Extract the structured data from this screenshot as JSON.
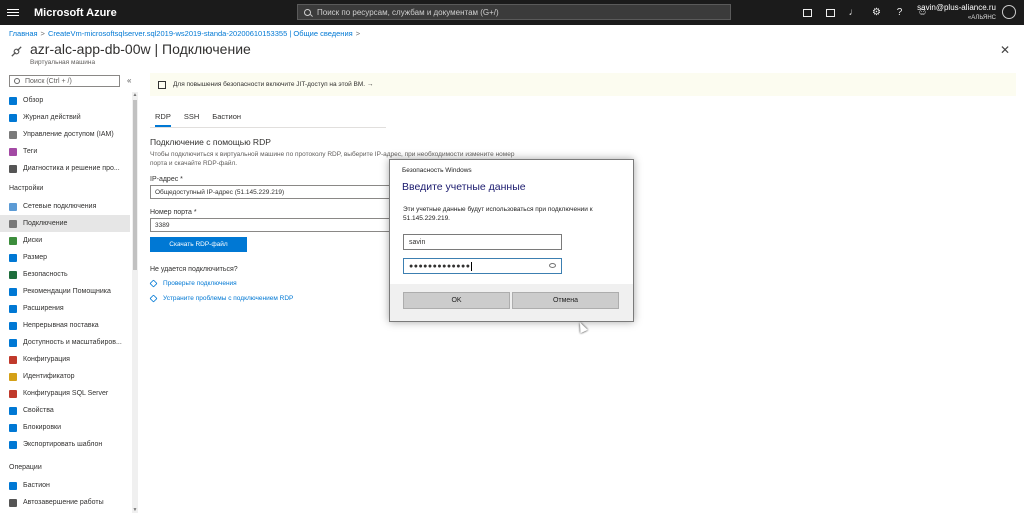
{
  "topbar": {
    "brand": "Microsoft Azure",
    "search_placeholder": "Поиск по ресурсам, службам и документам (G+/)",
    "icons": [
      "cloud-shell-icon",
      "directory-filter-icon",
      "notifications-icon",
      "settings-icon",
      "help-icon",
      "feedback-icon"
    ],
    "user_email": "savin@plus-aliance.ru",
    "user_org": "«АЛЬЯНС"
  },
  "breadcrumb": [
    "Главная",
    "CreateVm-microsoftsqlserver.sql2019-ws2019-standa-20200610153355 | Общие сведения"
  ],
  "page": {
    "title": "azr-alc-app-db-00w | Подключение",
    "subtitle": "Виртуальная машина"
  },
  "sidebar": {
    "search_placeholder": "Поиск (Ctrl + /)",
    "collapse_label": "«",
    "items_top": [
      {
        "label": "Обзор",
        "color": "#0078d4"
      },
      {
        "label": "Журнал действий",
        "color": "#0078d4"
      },
      {
        "label": "Управление доступом (IAM)",
        "color": "#7a7a7a"
      },
      {
        "label": "Теги",
        "color": "#a349a4"
      },
      {
        "label": "Диагностика и решение про...",
        "color": "#555555"
      }
    ],
    "section_settings": "Настройки",
    "items_settings": [
      {
        "label": "Сетевые подключения",
        "color": "#5c9bd5"
      },
      {
        "label": "Подключение",
        "color": "#777777",
        "selected": true
      },
      {
        "label": "Диски",
        "color": "#3c8d3c"
      },
      {
        "label": "Размер",
        "color": "#0078d4"
      },
      {
        "label": "Безопасность",
        "color": "#1e6e3c"
      },
      {
        "label": "Рекомендации Помощника",
        "color": "#0078d4"
      },
      {
        "label": "Расширения",
        "color": "#0078d4"
      },
      {
        "label": "Непрерывная поставка",
        "color": "#0078d4"
      },
      {
        "label": "Доступность и масштабиров...",
        "color": "#0078d4"
      },
      {
        "label": "Конфигурация",
        "color": "#c0392b"
      },
      {
        "label": "Идентификатор",
        "color": "#d4a017"
      },
      {
        "label": "Конфигурация SQL Server",
        "color": "#c0392b"
      },
      {
        "label": "Свойства",
        "color": "#0078d4"
      },
      {
        "label": "Блокировки",
        "color": "#0078d4"
      },
      {
        "label": "Экспортировать шаблон",
        "color": "#0078d4"
      }
    ],
    "section_operations": "Операции",
    "items_operations": [
      {
        "label": "Бастион",
        "color": "#0078d4"
      },
      {
        "label": "Автозавершение работы",
        "color": "#555555"
      }
    ]
  },
  "infobar": {
    "text": "Для повышения безопасности включите JIT-доступ на этой ВМ. →"
  },
  "tabs": [
    "RDP",
    "SSH",
    "Бастион"
  ],
  "rdp": {
    "section_title": "Подключение с помощью RDP",
    "description": "Чтобы подключиться к виртуальной машине по протоколу RDP, выберите IP-адрес, при необходимости измените номер порта и скачайте RDP-файл.",
    "ip_label": "IP-адрес *",
    "ip_value": "Общедоступный IP-адрес (51.145.229.219)",
    "port_label": "Номер порта *",
    "port_value": "3389",
    "download_button": "Скачать RDP-файл",
    "cant_connect": "Не удается подключиться?",
    "link_check": "Проверьте подключения",
    "link_troubleshoot": "Устраните проблемы с подключением RDP"
  },
  "dialog": {
    "caption": "Безопасность Windows",
    "title": "Введите учетные данные",
    "message": "Эти учетные данные будут использоваться при подключении к 51.145.229.219.",
    "username": "savin",
    "password_mask": "●●●●●●●●●●●●●",
    "ok": "OK",
    "cancel": "Отмена"
  }
}
